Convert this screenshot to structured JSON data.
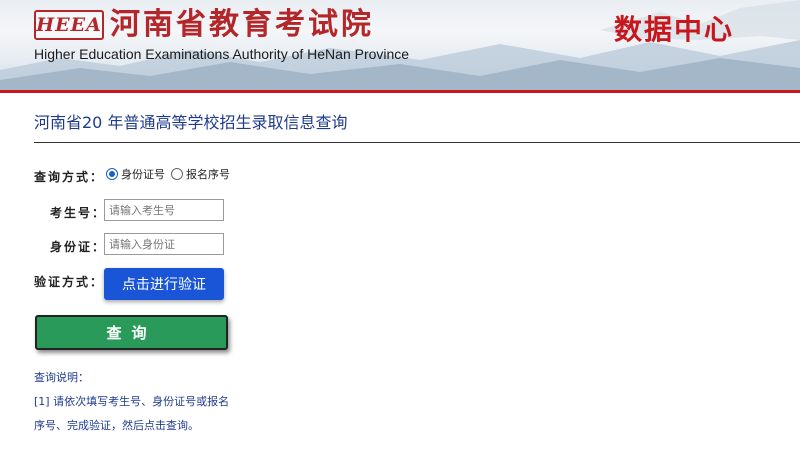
{
  "header": {
    "logo_text": "HEEA",
    "org_name_cn": "河南省教育考试院",
    "org_name_en": "Higher Education Examinations Authority of HeNan Province",
    "data_center": "数据中心",
    "accent_color": "#c8161d"
  },
  "page": {
    "title": "河南省20  年普通高等学校招生录取信息查询"
  },
  "form": {
    "query_method_label": "查询方式：",
    "options": [
      {
        "label": "身份证号",
        "selected": true
      },
      {
        "label": "报名序号",
        "selected": false
      }
    ],
    "exam_no_label": "考生号：",
    "exam_no_placeholder": "请输入考生号",
    "id_card_label": "身份证：",
    "id_card_placeholder": "请输入身份证",
    "verify_label": "验证方式：",
    "verify_button": "点击进行验证",
    "query_button": "查询"
  },
  "notes": {
    "heading": "查询说明：",
    "line1": "[1] 请依次填写考生号、身份证号或报名序号、完成验证，然后点击查询。"
  }
}
